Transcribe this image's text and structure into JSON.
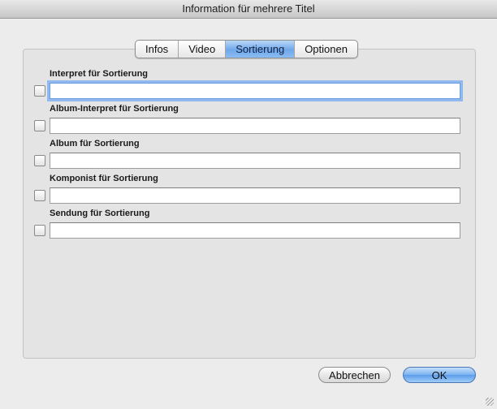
{
  "window": {
    "title": "Information für mehrere Titel"
  },
  "tabs": [
    {
      "label": "Infos",
      "selected": false
    },
    {
      "label": "Video",
      "selected": false
    },
    {
      "label": "Sortierung",
      "selected": true
    },
    {
      "label": "Optionen",
      "selected": false
    }
  ],
  "fields": [
    {
      "label": "Interpret für Sortierung",
      "value": "",
      "checked": false,
      "focused": true
    },
    {
      "label": "Album-Interpret für Sortierung",
      "value": "",
      "checked": false,
      "focused": false
    },
    {
      "label": "Album für Sortierung",
      "value": "",
      "checked": false,
      "focused": false
    },
    {
      "label": "Komponist für Sortierung",
      "value": "",
      "checked": false,
      "focused": false
    },
    {
      "label": "Sendung für Sortierung",
      "value": "",
      "checked": false,
      "focused": false
    }
  ],
  "buttons": {
    "cancel": "Abbrechen",
    "ok": "OK"
  },
  "colors": {
    "accent": "#6ea7ea",
    "focus_ring": "#8fb9ef"
  }
}
